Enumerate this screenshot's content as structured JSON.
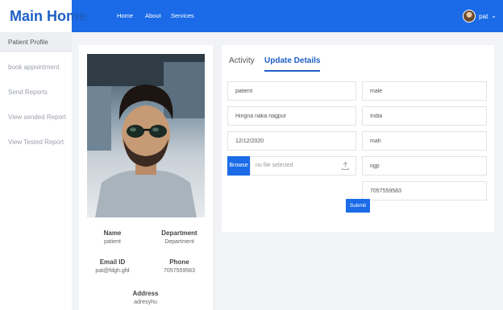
{
  "brand": "Main Home",
  "nav": {
    "home": "Home",
    "about": "About",
    "services": "Services"
  },
  "user": {
    "name": "pat"
  },
  "sidebar": {
    "items": [
      {
        "label": "Patient Profile"
      },
      {
        "label": "book appointment"
      },
      {
        "label": "Send Reports"
      },
      {
        "label": "View sended Report"
      },
      {
        "label": "View Tested Report"
      }
    ]
  },
  "profile": {
    "name_label": "Name",
    "name_value": "patient",
    "department_label": "Department",
    "department_value": "Department",
    "email_label": "Email ID",
    "email_value": "pat@fdgh.gfd",
    "phone_label": "Phone",
    "phone_value": "7057559583",
    "address_label": "Address",
    "address_value": "adresyhu"
  },
  "tabs": {
    "activity": "Activity",
    "update": "Update Details"
  },
  "form": {
    "name": "patient",
    "gender": "male",
    "address": "Hingna naka nagpur",
    "country": "India",
    "dob": "12/12/2020",
    "state": "mah",
    "browse_label": "Browse",
    "file_status": "no file selected",
    "city": "ngp",
    "phone": "7057559583",
    "submit_label": "Submit"
  },
  "colors": {
    "primary": "#1b6be8",
    "brand_text": "#1f5fc6"
  }
}
